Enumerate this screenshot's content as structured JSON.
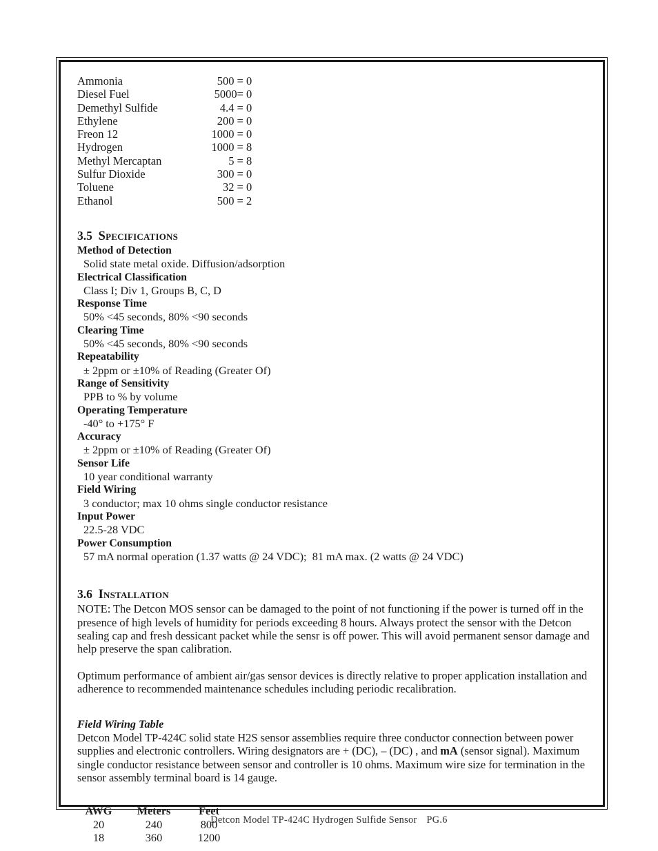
{
  "cross_sensitivity": {
    "rows": [
      {
        "gas": "Ammonia",
        "concentration": "500",
        "separator": " = ",
        "response": "0"
      },
      {
        "gas": "Diesel Fuel",
        "concentration": "5000",
        "separator": "= ",
        "response": "0"
      },
      {
        "gas": "Demethyl Sulfide",
        "concentration": "4.4",
        "separator": " = ",
        "response": "0"
      },
      {
        "gas": "Ethylene",
        "concentration": "200",
        "separator": " = ",
        "response": "0"
      },
      {
        "gas": "Freon 12",
        "concentration": "1000",
        "separator": " = ",
        "response": "0"
      },
      {
        "gas": "Hydrogen",
        "concentration": "1000",
        "separator": " = ",
        "response": "8"
      },
      {
        "gas": "Methyl Mercaptan",
        "concentration": "5",
        "separator": " = ",
        "response": "8"
      },
      {
        "gas": "Sulfur Dioxide",
        "concentration": "300",
        "separator": " = ",
        "response": "0"
      },
      {
        "gas": "Toluene",
        "concentration": "32",
        "separator": " = ",
        "response": "0"
      },
      {
        "gas": "Ethanol",
        "concentration": "500",
        "separator": " = ",
        "response": "2"
      }
    ]
  },
  "specifications": {
    "number": "3.5",
    "title": "Specifications",
    "items": [
      {
        "label": "Method of Detection",
        "value": "Solid state metal oxide. Diffusion/adsorption"
      },
      {
        "label": "Electrical Classification",
        "value": "Class I; Div 1, Groups B, C, D"
      },
      {
        "label": "Response Time",
        "value": "50% <45 seconds, 80% <90 seconds"
      },
      {
        "label": "Clearing Time",
        "value": "50% <45 seconds, 80% <90 seconds"
      },
      {
        "label": "Repeatability",
        "value": "± 2ppm or ±10% of Reading (Greater Of)"
      },
      {
        "label": "Range of Sensitivity",
        "value": "PPB to % by volume"
      },
      {
        "label": "Operating Temperature",
        "value": "-40° to +175° F"
      },
      {
        "label": "Accuracy",
        "value": "± 2ppm or ±10% of Reading (Greater Of)"
      },
      {
        "label": "Sensor Life",
        "value": "10 year conditional warranty"
      },
      {
        "label": "Field Wiring",
        "value": "3 conductor; max 10 ohms single conductor resistance"
      },
      {
        "label": "Input Power",
        "value": "22.5-28 VDC"
      },
      {
        "label": "Power Consumption",
        "value": "57 mA normal operation (1.37 watts @ 24 VDC);  81 mA max. (2 watts @ 24 VDC)"
      }
    ]
  },
  "installation": {
    "number": "3.6",
    "title": "Installation",
    "note_paragraph": "NOTE: The Detcon MOS sensor can be damaged to the point of not functioning if the power is turned off in the presence of high levels of humidity for periods exceeding 8 hours. Always protect the sensor with the Detcon sealing cap and fresh dessicant packet while the sensr is off power. This will avoid permanent sensor damage and help preserve the span calibration.",
    "optimum_paragraph": "Optimum performance of ambient air/gas sensor devices is directly relative to proper application installation and adherence to recommended maintenance schedules including periodic recalibration."
  },
  "field_wiring": {
    "heading": "Field Wiring Table",
    "paragraph_part1": "Detcon Model TP-424C solid state H2S sensor assemblies require three conductor connection between power supplies and electronic controllers. Wiring designators are + (DC), – (DC) , and ",
    "paragraph_bold": "mA",
    "paragraph_part2": " (sensor signal). Maximum single conductor resistance between sensor and controller is 10 ohms. Maximum wire size for termination in the sensor assembly terminal board is 14 gauge.",
    "table": {
      "headers": [
        "AWG",
        "Meters",
        "Feet"
      ],
      "rows": [
        [
          "20",
          "240",
          "800"
        ],
        [
          "18",
          "360",
          "1200"
        ]
      ]
    }
  },
  "footer": {
    "document_title": "Detcon Model TP-424C Hydrogen Sulfide Sensor",
    "page_label": "PG.6"
  }
}
